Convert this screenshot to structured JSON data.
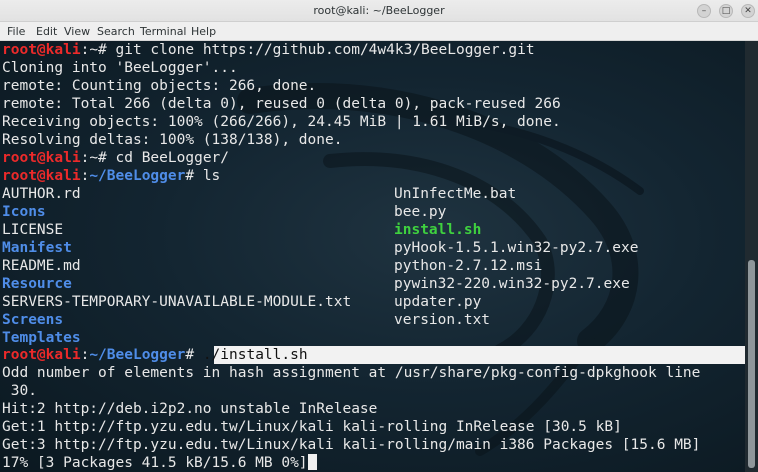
{
  "window": {
    "title": "root@kali: ~/BeeLogger",
    "minimize_glyph": "–",
    "maximize_glyph": "□",
    "close_glyph": "✕"
  },
  "menu": [
    "File",
    "Edit",
    "View",
    "Search",
    "Terminal",
    "Help"
  ],
  "prompt": {
    "user_host": "root@kali",
    "sep": ":",
    "home_path": "~",
    "repo_path": "~/BeeLogger",
    "hash_home": "# ",
    "hash_repo": "# "
  },
  "commands": {
    "clone": "git clone https://github.com/4w4k3/BeeLogger.git",
    "cd": "cd BeeLogger/",
    "ls": "ls",
    "install": "./install.sh"
  },
  "clone_output": [
    "Cloning into 'BeeLogger'...",
    "remote: Counting objects: 266, done.",
    "remote: Total 266 (delta 0), reused 0 (delta 0), pack-reused 266",
    "Receiving objects: 100% (266/266), 24.45 MiB | 1.61 MiB/s, done.",
    "Resolving deltas: 100% (138/138), done."
  ],
  "ls_left": [
    {
      "name": "AUTHOR.rd",
      "kind": "file"
    },
    {
      "name": "Icons",
      "kind": "dir"
    },
    {
      "name": "LICENSE",
      "kind": "file"
    },
    {
      "name": "Manifest",
      "kind": "dir"
    },
    {
      "name": "README.md",
      "kind": "file"
    },
    {
      "name": "Resource",
      "kind": "dir"
    },
    {
      "name": "SERVERS-TEMPORARY-UNAVAILABLE-MODULE.txt",
      "kind": "file"
    },
    {
      "name": "Screens",
      "kind": "dir"
    },
    {
      "name": "Templates",
      "kind": "dir"
    }
  ],
  "ls_right": [
    {
      "name": "UnInfectMe.bat",
      "kind": "file"
    },
    {
      "name": "bee.py",
      "kind": "file"
    },
    {
      "name": "install.sh",
      "kind": "exec"
    },
    {
      "name": "pyHook-1.5.1.win32-py2.7.exe",
      "kind": "file"
    },
    {
      "name": "python-2.7.12.msi",
      "kind": "file"
    },
    {
      "name": "pywin32-220.win32-py2.7.exe",
      "kind": "file"
    },
    {
      "name": "updater.py",
      "kind": "file"
    },
    {
      "name": "version.txt",
      "kind": "file"
    }
  ],
  "install_output": [
    "Odd number of elements in hash assignment at /usr/share/pkg-config-dpkghook line",
    " 30.",
    "Hit:2 http://deb.i2p2.no unstable InRelease",
    "Get:1 http://ftp.yzu.edu.tw/Linux/kali kali-rolling InRelease [30.5 kB]",
    "Get:3 http://ftp.yzu.edu.tw/Linux/kali kali-rolling/main i386 Packages [15.6 MB]",
    "17% [3 Packages 41.5 kB/15.6 MB 0%]"
  ],
  "colors": {
    "prompt_user": "#ec2a2a",
    "prompt_path": "#4f8de8",
    "directory": "#4f8de8",
    "executable": "#3fd13f",
    "text": "#e8e8e8",
    "background": "#132531"
  }
}
